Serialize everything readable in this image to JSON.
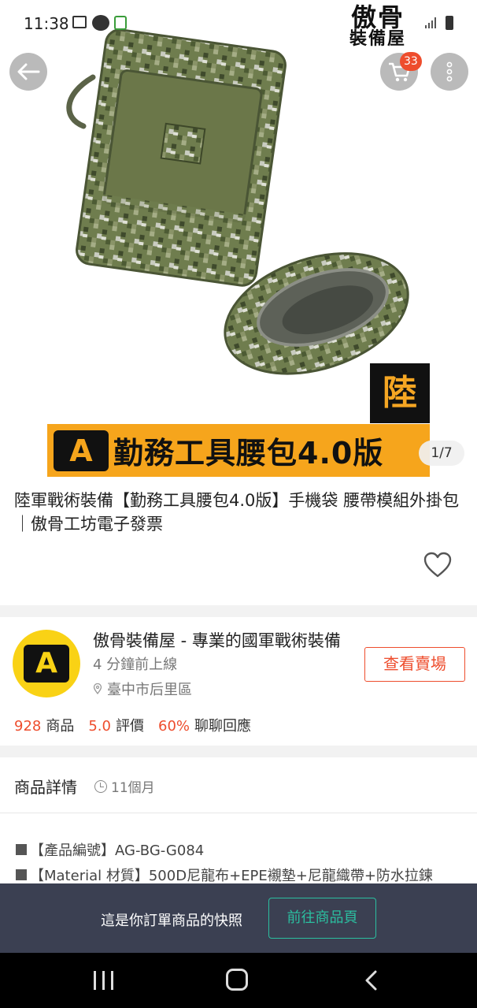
{
  "status_bar": {
    "time": "11:38"
  },
  "brand_logo": {
    "line1": "傲骨",
    "line2": "裝備屋"
  },
  "cart": {
    "badge_count": "33"
  },
  "hero": {
    "corner_tag": "陸",
    "banner_logo": "A",
    "banner_text": "勤務工具腰包4.0版",
    "image_counter": "1/7"
  },
  "product": {
    "title": "陸軍戰術裝備【勤務工具腰包4.0版】手機袋 腰帶模組外掛包｜傲骨工坊電子發票"
  },
  "shop": {
    "avatar_letter": "A",
    "name": "傲骨裝備屋 - 專業的國軍戰術裝備",
    "online_status": "4 分鐘前上線",
    "location": "臺中市后里區",
    "view_shop_label": "查看賣場",
    "stats": [
      {
        "value": "928",
        "label": "商品"
      },
      {
        "value": "5.0",
        "label": "評價"
      },
      {
        "value": "60%",
        "label": "聊聊回應"
      }
    ]
  },
  "details": {
    "title": "商品詳情",
    "time_ago": "11個月",
    "lines": [
      "【產品編號】AG-BG-G084",
      "【Material 材質】500D尼龍布+EPE襯墊+尼龍織帶+防水拉鍊"
    ]
  },
  "snapshot_bar": {
    "text": "這是你訂單商品的快照",
    "button_label": "前往商品頁"
  },
  "colors": {
    "accent": "#ee4d2d",
    "teal": "#2bbfa0",
    "banner_orange": "#f6a51c",
    "dark_bar": "#3b4052"
  }
}
